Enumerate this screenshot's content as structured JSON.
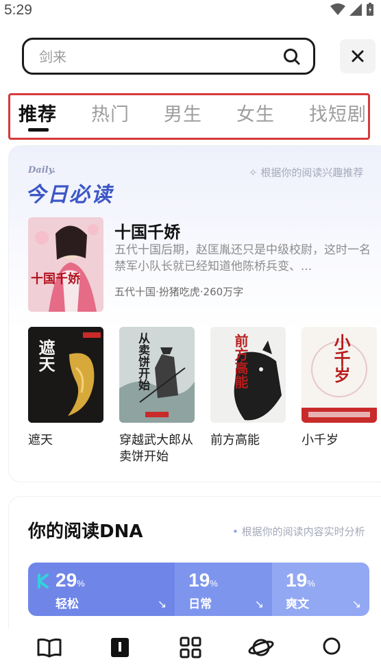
{
  "status": {
    "time": "5:29"
  },
  "search": {
    "placeholder": "剑来"
  },
  "tabs": [
    "推荐",
    "热门",
    "男生",
    "女生",
    "找短剧"
  ],
  "daily": {
    "en_label": "Daily.",
    "title": "今日必读",
    "hint": "根据你的阅读兴趣推荐",
    "featured": {
      "title": "十国千娇",
      "description": "五代十国后期，赵匡胤还只是中级校尉，这时一名禁军小队长就已经知道他陈桥兵变、...",
      "tags": "五代十国·扮猪吃虎·260万字",
      "cover_text": "十国千娇"
    },
    "books": [
      {
        "title": "遮天",
        "cover_text": "遮天"
      },
      {
        "title": "穿越武大郎从卖饼开始",
        "cover_text": "从卖饼开始"
      },
      {
        "title": "前方高能",
        "cover_text": "前方高能"
      },
      {
        "title": "小千岁",
        "cover_text": "小千岁"
      }
    ]
  },
  "dna": {
    "title": "你的阅读DNA",
    "hint": "根据你的阅读内容实时分析",
    "segments": [
      {
        "percent": "29",
        "unit": "%",
        "label": "轻松",
        "share": 0.43,
        "color": "#6f86e8"
      },
      {
        "percent": "19",
        "unit": "%",
        "label": "日常",
        "share": 0.285,
        "color": "#7e95ee"
      },
      {
        "percent": "19",
        "unit": "%",
        "label": "爽文",
        "share": 0.285,
        "color": "#93a8f3"
      }
    ]
  },
  "colors": {
    "accent": "#3c57c6",
    "tab_border": "#d6393a"
  }
}
